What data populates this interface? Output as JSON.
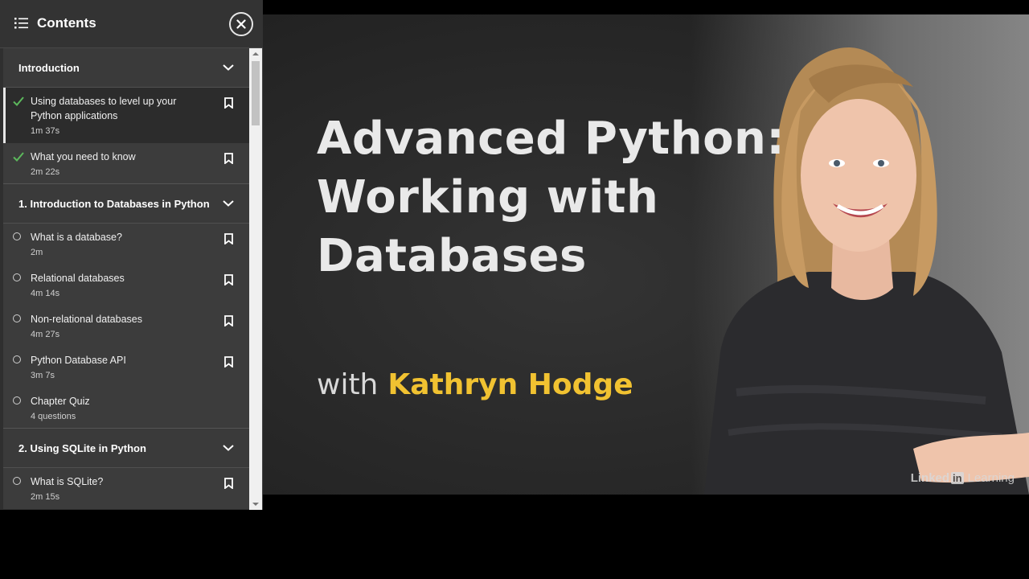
{
  "sidebar": {
    "title": "Contents",
    "list_icon": "list-icon",
    "close_icon": "close-icon",
    "sections": [
      {
        "label": "Introduction",
        "items": [
          {
            "title": "Using databases to level up your Python applications",
            "duration": "1m 37s",
            "status": "completed",
            "active": true
          },
          {
            "title": "What you need to know",
            "duration": "2m 22s",
            "status": "completed",
            "active": false
          }
        ]
      },
      {
        "label": "1. Introduction to Databases in Python",
        "items": [
          {
            "title": "What is a database?",
            "duration": "2m",
            "status": "not-started",
            "active": false
          },
          {
            "title": "Relational databases",
            "duration": "4m 14s",
            "status": "not-started",
            "active": false
          },
          {
            "title": "Non-relational databases",
            "duration": "4m 27s",
            "status": "not-started",
            "active": false
          },
          {
            "title": "Python Database API",
            "duration": "3m 7s",
            "status": "not-started",
            "active": false
          },
          {
            "title": "Chapter Quiz",
            "duration": "4 questions",
            "status": "not-started",
            "active": false
          }
        ]
      },
      {
        "label": "2. Using SQLite in Python",
        "items": [
          {
            "title": "What is SQLite?",
            "duration": "2m 15s",
            "status": "not-started",
            "active": false
          }
        ]
      }
    ]
  },
  "video": {
    "title": "Advanced Python:\nWorking with\nDatabases",
    "byline_prefix": "with",
    "author": "Kathryn Hodge",
    "brand_linked": "Linked",
    "brand_in": "in",
    "brand_learning": "Learning"
  },
  "colors": {
    "accent_yellow": "#f1c231",
    "check_green": "#5cb85c",
    "sidebar_bg": "#2f2f2f"
  }
}
